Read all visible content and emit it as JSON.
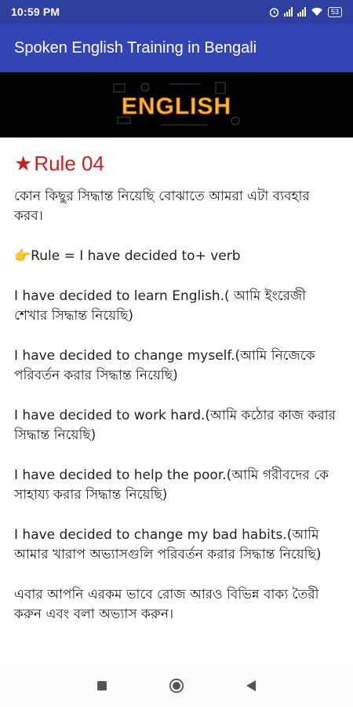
{
  "status_bar": {
    "time": "10:59 PM",
    "battery": "53"
  },
  "app_bar": {
    "title": "Spoken English Training in Bengali"
  },
  "banner": {
    "logo_text": "ENGLISH"
  },
  "content": {
    "rule_star": "★",
    "rule_title": "Rule 04",
    "paragraphs": [
      "কোন কিছুর সিদ্ধান্ত নিয়েছি বোঝাতে আমরা এটা ব্যবহার করব।",
      "👉Rule = I have decided to+ verb",
      "I have decided to learn English.( আমি ইংরেজী শেখার সিদ্ধান্ত নিয়েছি)",
      "I have decided to change myself.(আমি নিজেকে পরিবর্তন করার সিদ্ধান্ত নিয়েছি)",
      "I have decided to work hard.(আমি কঠোর কাজ করার সিদ্ধান্ত নিয়েছি)",
      "I have decided to help the poor.(আমি গরীবদের কে সাহায্য করার সিদ্ধান্ত নিয়েছি)",
      "I have decided to change my bad habits.(আমি আমার খারাপ অভ্যাসগুলি পরিবর্তন করার সিদ্ধান্ত নিয়েছি)",
      " এবার আপনি এরকম ভাবে রোজ আরও বিভিন্ন বাক্য তৈরী করুন এবং বলা অভ্যাস করুন।"
    ]
  },
  "nav_icons": [
    "recents-square-icon",
    "home-circle-icon",
    "back-triangle-icon"
  ],
  "colors": {
    "status_bar": "#2f3fa0",
    "app_bar": "#3345b5",
    "rule_title": "#c91f1f"
  }
}
